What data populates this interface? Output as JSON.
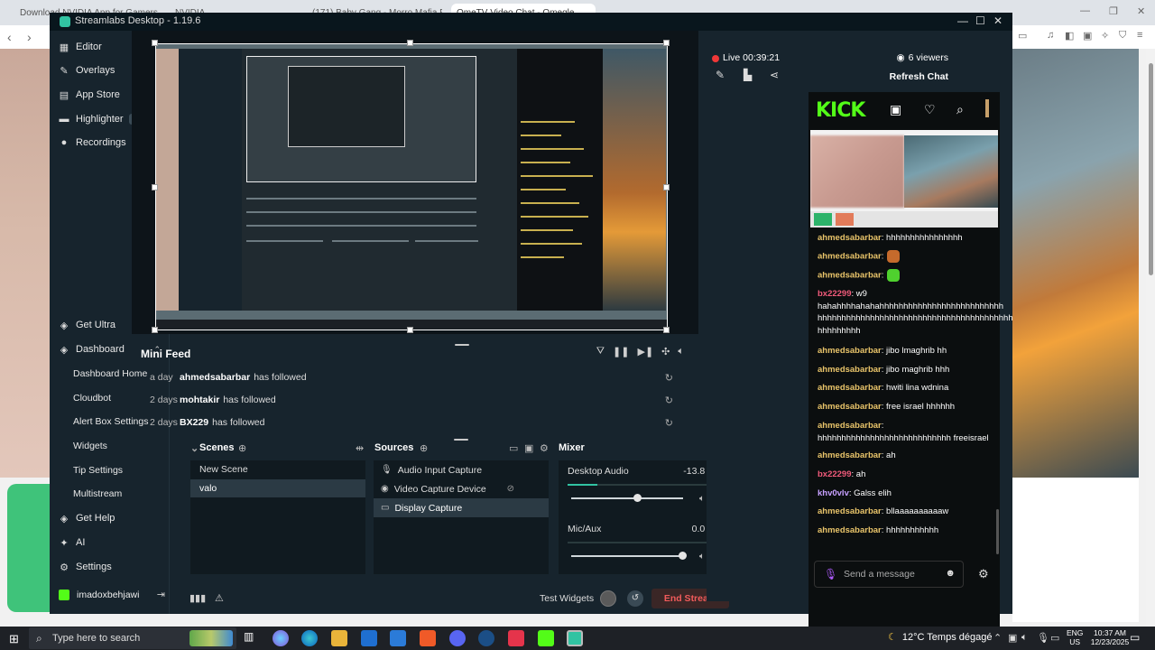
{
  "browser": {
    "tabs": [
      {
        "label": "Download NVIDIA App for Gamers"
      },
      {
        "label": "NVIDIA"
      },
      {
        "label": "(171) Baby Gang - Morro Mafia Feat"
      },
      {
        "label": "OmeTV Video Chat - Omegle"
      }
    ]
  },
  "app": {
    "title": "Streamlabs Desktop - 1.19.6"
  },
  "sidebar": {
    "items": [
      {
        "label": "Editor",
        "icon": "grid-icon"
      },
      {
        "label": "Overlays",
        "icon": "overlays-icon"
      },
      {
        "label": "App Store",
        "icon": "store-icon"
      },
      {
        "label": "Highlighter",
        "icon": "highlighter-icon",
        "badge": "beta"
      },
      {
        "label": "Recordings",
        "icon": "record-icon"
      }
    ],
    "bottom": {
      "get_ultra": "Get Ultra",
      "dashboard": "Dashboard",
      "dashboard_children": [
        "Dashboard Home",
        "Cloudbot",
        "Alert Box Settings",
        "Widgets",
        "Tip Settings",
        "Multistream"
      ],
      "get_help": "Get Help",
      "ai": "AI",
      "settings": "Settings",
      "username": "imadoxbehjawi"
    }
  },
  "mini_feed": {
    "title": "Mini Feed",
    "rows": [
      {
        "age": "a day",
        "name": "ahmedsabarbar",
        "action": "has followed"
      },
      {
        "age": "2 days",
        "name": "mohtakir",
        "action": "has followed"
      },
      {
        "age": "2 days",
        "name": "BX229",
        "action": "has followed"
      }
    ]
  },
  "scenes": {
    "title": "Scenes",
    "items": [
      {
        "label": "New Scene",
        "selected": false
      },
      {
        "label": "valo",
        "selected": true
      }
    ]
  },
  "sources": {
    "title": "Sources",
    "items": [
      {
        "label": "Audio Input Capture",
        "icon": "mic-icon",
        "selected": false
      },
      {
        "label": "Video Capture Device",
        "icon": "camera-icon",
        "selected": false
      },
      {
        "label": "Display Capture",
        "icon": "monitor-icon",
        "selected": true
      }
    ]
  },
  "mixer": {
    "title": "Mixer",
    "channels": [
      {
        "name": "Desktop Audio",
        "db": "-13.8 dB",
        "level": 0.6,
        "meter": 0.2
      },
      {
        "name": "Mic/Aux",
        "db": "0.0 dB",
        "level": 1.0,
        "meter": 0.0
      }
    ]
  },
  "footer": {
    "test_widgets": "Test Widgets",
    "end_stream": "End Stream"
  },
  "dock": {
    "live": "Live 00:39:21",
    "viewers": "6 viewers",
    "refresh": "Refresh Chat"
  },
  "kick": {
    "logo": "KICK",
    "send_placeholder": "Send a message",
    "messages": [
      {
        "user": "ahmedsabarbar",
        "color": "gold",
        "text": ": hhhhhhhhhhhhhhhh"
      },
      {
        "user": "ahmedsabarbar",
        "color": "gold",
        "text": ":",
        "emoji": "#c56a2c"
      },
      {
        "user": "ahmedsabarbar",
        "color": "gold",
        "text": ":",
        "emoji": "#4fd12e"
      },
      {
        "user": "bx22299",
        "color": "red",
        "text": ": w9 hahahhhhahahahhhhhhhhhhhhhhhhhhhhhhhhhh hhhhhhhhhhhhhhhhhhhhhhhhhhhhhhhhhhhhhhhhh hhhhhhhhh"
      },
      {
        "user": "ahmedsabarbar",
        "color": "gold",
        "text": ": jibo lmaghrib hh"
      },
      {
        "user": "ahmedsabarbar",
        "color": "gold",
        "text": ": jibo maghrib hhh"
      },
      {
        "user": "ahmedsabarbar",
        "color": "gold",
        "text": ": hwiti lina wdnina"
      },
      {
        "user": "ahmedsabarbar",
        "color": "gold",
        "text": ": free israel hhhhhh"
      },
      {
        "user": "ahmedsabarbar",
        "color": "gold",
        "text": ": hhhhhhhhhhhhhhhhhhhhhhhhhhhh freeisrael"
      },
      {
        "user": "ahmedsabarbar",
        "color": "gold",
        "text": ": ah"
      },
      {
        "user": "bx22299",
        "color": "red",
        "text": ": ah"
      },
      {
        "user": "khv0vlv",
        "color": "purple",
        "text": ": Galss elih"
      },
      {
        "user": "ahmedsabarbar",
        "color": "gold",
        "text": ": bllaaaaaaaaaaw"
      },
      {
        "user": "ahmedsabarbar",
        "color": "gold",
        "text": ": hhhhhhhhhhh"
      }
    ]
  },
  "taskbar": {
    "search_placeholder": "Type here to search",
    "weather": "12°C  Temps dégagé",
    "lang_top": "ENG",
    "lang_bottom": "US",
    "time": "10:37 AM",
    "date": "12/23/2025"
  },
  "colors": {
    "accent": "#31c3a2",
    "kick_green": "#53fc18",
    "live_red": "#f03838",
    "end_stream_text": "#f15b5b"
  }
}
